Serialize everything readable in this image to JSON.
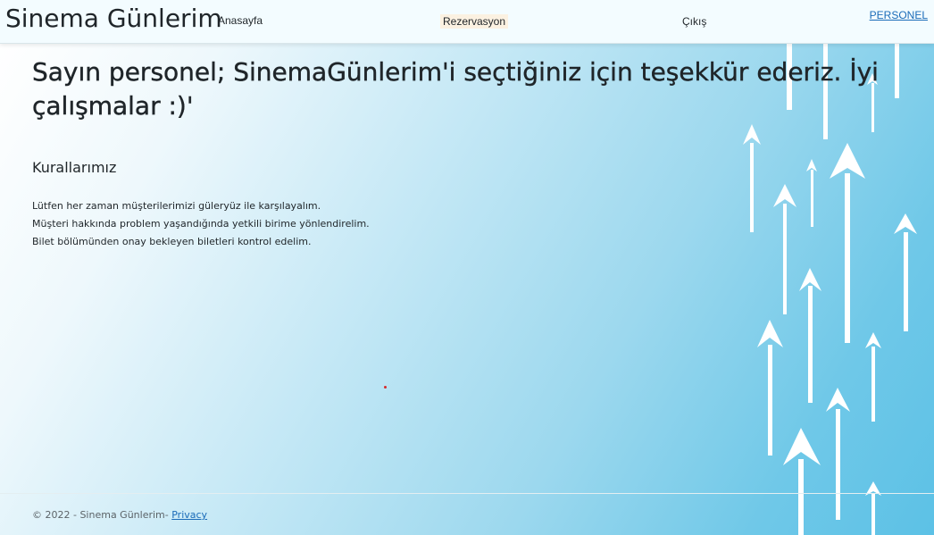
{
  "header": {
    "brand": "Sinema Günlerim",
    "nav": {
      "home": "Anasayfa",
      "reservation": "Rezervasyon",
      "exit": "Çıkış"
    },
    "user": "PERSONEL"
  },
  "main": {
    "title": "Sayın personel; SinemaGünlerim'i seçtiğiniz için teşekkür ederiz. İyi çalışmalar :)'",
    "rules_heading": "Kurallarımız",
    "rules": [
      "Lütfen her zaman müşterilerimizi güleryüz ile karşılayalım.",
      "Müşteri hakkında problem yaşandığında yetkili birime yönlendirelim.",
      "Bilet bölümünden onay bekleyen biletleri kontrol edelim."
    ]
  },
  "footer": {
    "text": "© 2022 - Sinema Günlerim- ",
    "privacy_link": "Privacy"
  },
  "colors": {
    "accent_link": "#1a6bb8",
    "background_gradient_end": "#5cc1e6"
  }
}
